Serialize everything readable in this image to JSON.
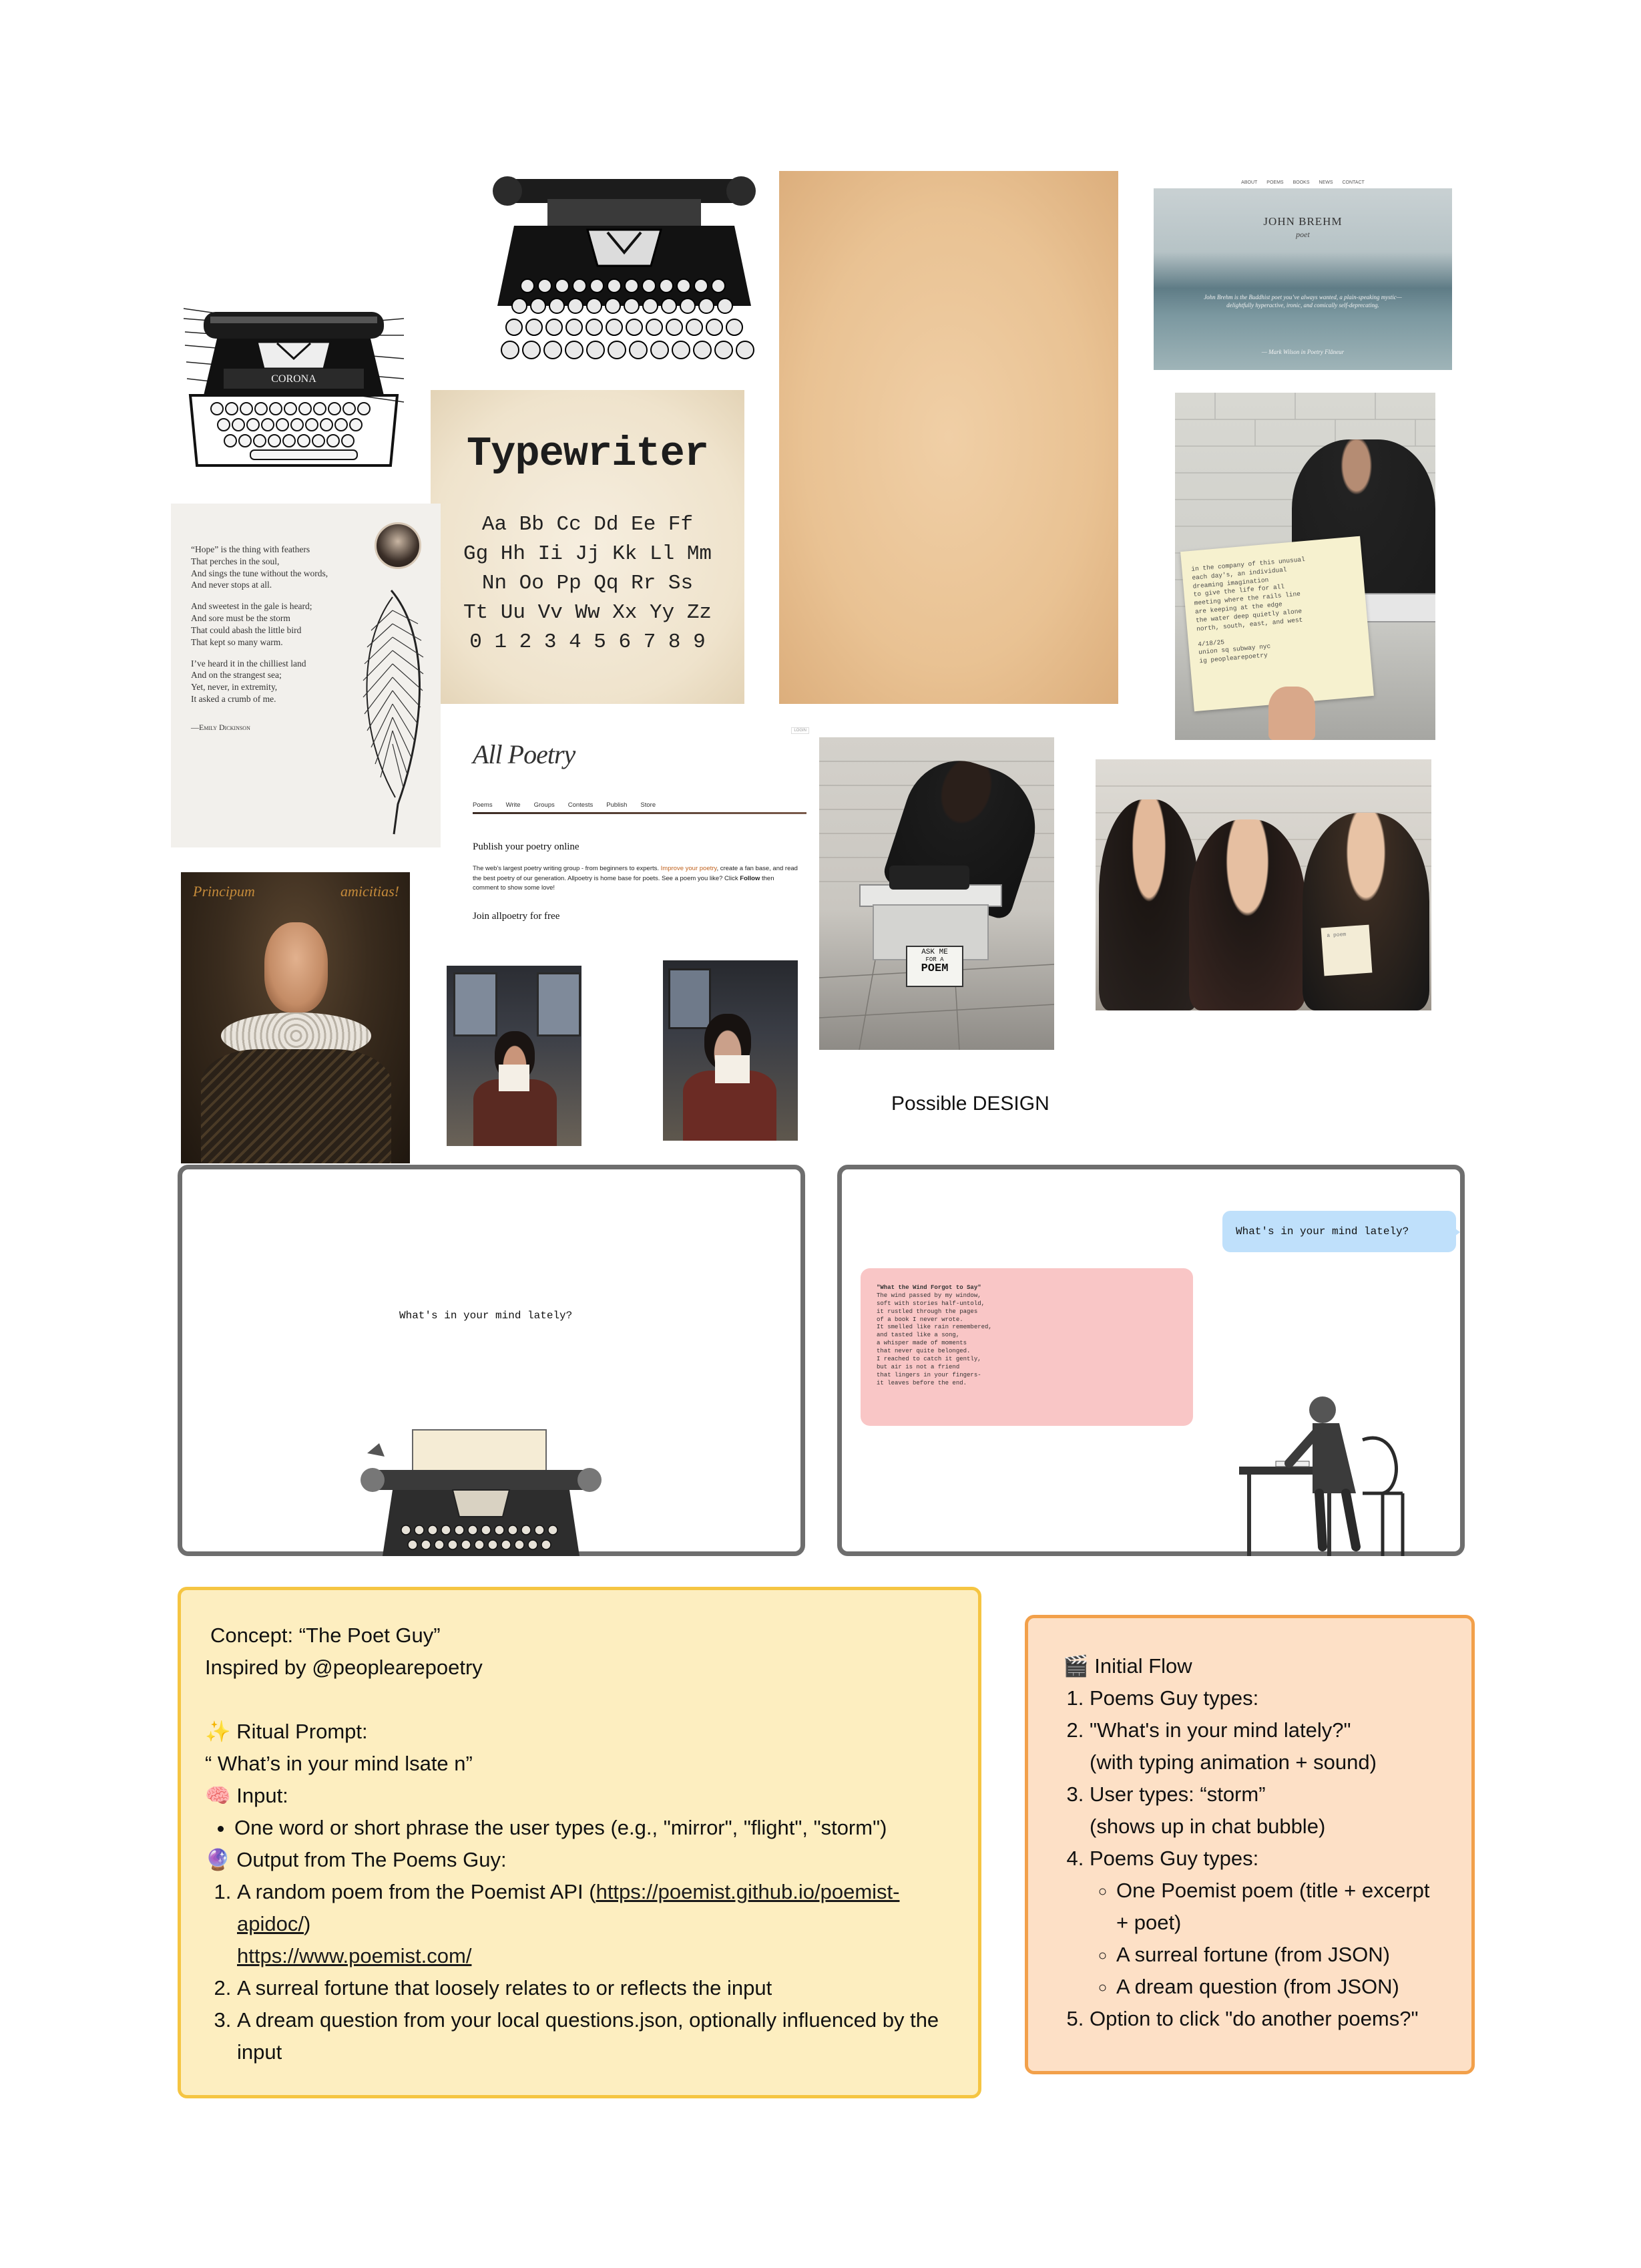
{
  "moodboard": {
    "emily": {
      "poem_lines": [
        "“Hope” is the thing with feathers",
        "That perches in the soul,",
        "And sings the tune without the words,",
        "And never stops at all.",
        "",
        "And sweetest in the gale is heard;",
        "And sore must be the storm",
        "That could abash the little bird",
        "That kept so many warm.",
        "",
        "I’ve heard it in the chilliest land",
        "And on the strangest sea;",
        "Yet, never, in extremity,",
        "It asked a crumb of me."
      ],
      "author": "—Emily Dickinson"
    },
    "corona_label": "CORONA",
    "typewriter_font": {
      "title": "Typewriter",
      "rows": [
        "Aa Bb Cc Dd Ee Ff",
        "Gg Hh Ii Jj Kk Ll Mm",
        "Nn Oo Pp Qq Rr Ss",
        "Tt Uu Vv Ww Xx Yy Zz",
        "0 1 2 3 4 5 6 7 8 9"
      ]
    },
    "brehm": {
      "nav": [
        "ABOUT",
        "POEMS",
        "BOOKS",
        "NEWS",
        "CONTACT"
      ],
      "name": "JOHN BREHM",
      "subtitle": "poet",
      "quote": "John Brehm is the Buddhist poet you’ve always wanted, a plain-speaking mystic—delightfully hyperactive, ironic, and comically self-deprecating.",
      "attribution": "— Mark Wilson in Poetry Flâneur"
    },
    "note_card": {
      "lines": [
        "in the company of this unusual",
        "each day's, an individual",
        "dreaming imagination",
        "to give the life for all",
        "meeting where the rails line",
        "are keeping at the edge",
        "the water deep quietly alone",
        "north, south, east, and west",
        "",
        "4/18/25",
        "union sq subway nyc",
        "ig peoplearepoetry"
      ]
    },
    "allpoetry": {
      "logo": "All Poetry",
      "login": "LOGIN",
      "nav": [
        "Poems",
        "Write",
        "Groups",
        "Contests",
        "Publish",
        "Store"
      ],
      "heading": "Publish your poetry online",
      "body_before": "The web's largest poetry writing group - from beginners to experts. ",
      "body_link": "Improve your poetry",
      "body_after": ", create a fan base, and read the best poetry of our generation. Allpoetry is home base for poets. See a poem you like? Click ",
      "body_bold": "Follow",
      "body_end": " then comment to show some love!",
      "cta": "Join allpoetry for free"
    },
    "shakespeare": {
      "left": "Principum",
      "right": "amicitias!"
    },
    "sign": {
      "top": "ASK ME",
      "mid": "FOR A",
      "bottom": "POEM"
    },
    "selfie_note": "a poem"
  },
  "design": {
    "label": "Possible DESIGN",
    "screen1": {
      "prompt": "What's in your mind lately?"
    },
    "screen2": {
      "user_bubble": "What's in your mind lately?",
      "poem_lines": [
        "\"What the Wind Forgot to Say\"",
        "The wind passed by my window,",
        "soft with stories half-untold,",
        "it rustled through the pages",
        "of a book I never wrote.",
        "It smelled like rain remembered,",
        "and tasted like a song,",
        "a whisper made of moments",
        "that never quite belonged.",
        "I reached to catch it gently,",
        "but air is not a friend",
        "that lingers in your fingers-",
        "it leaves before the end."
      ]
    }
  },
  "concept": {
    "title": "Concept: “The Poet Guy”",
    "inspired": "Inspired by @peoplearepoetry",
    "ritual_emoji": "✨",
    "ritual_label": "Ritual Prompt:",
    "ritual_text": "“ What’s in your mind lsate n”",
    "input_emoji": "🧠",
    "input_label": "Input:",
    "input_bullet": "One word or short phrase the user types (e.g., \"mirror\", \"flight\", \"storm\")",
    "output_emoji": "🔮",
    "output_label": "Output from The Poems Guy:",
    "output_1_text": "A random poem from the Poemist API (",
    "output_1_link1": "https://poemist.github.io/poemist-apidoc/",
    "output_1_close": ")",
    "output_1_link2": "https://www.poemist.com/",
    "output_2": "A surreal fortune that loosely relates to or reflects the input",
    "output_3": "A dream question from your local questions.json, optionally influenced by the input"
  },
  "flow": {
    "emoji": "🎬",
    "title": "Initial Flow",
    "step1": "Poems Guy types:",
    "step2": "\"What's in your mind lately?\"",
    "step2_sub": "(with typing animation + sound)",
    "step3": "User types: “storm”",
    "step3_sub": "(shows up in chat bubble)",
    "step4": "Poems Guy types:",
    "step4_items": [
      "One Poemist poem (title + excerpt + poet)",
      "A surreal fortune (from JSON)",
      "A dream question (from JSON)"
    ],
    "step5": "Option to click \"do another poems?\""
  },
  "colors": {
    "concept_bg": "#fdeec0",
    "concept_border": "#f5c542",
    "flow_bg": "#fde0c6",
    "flow_border": "#f2a04a",
    "frame_border": "#6e6e6e",
    "chat_user": "#bfe0fb",
    "chat_poem": "#f9c6c6",
    "paper": "#ecc9a0"
  }
}
